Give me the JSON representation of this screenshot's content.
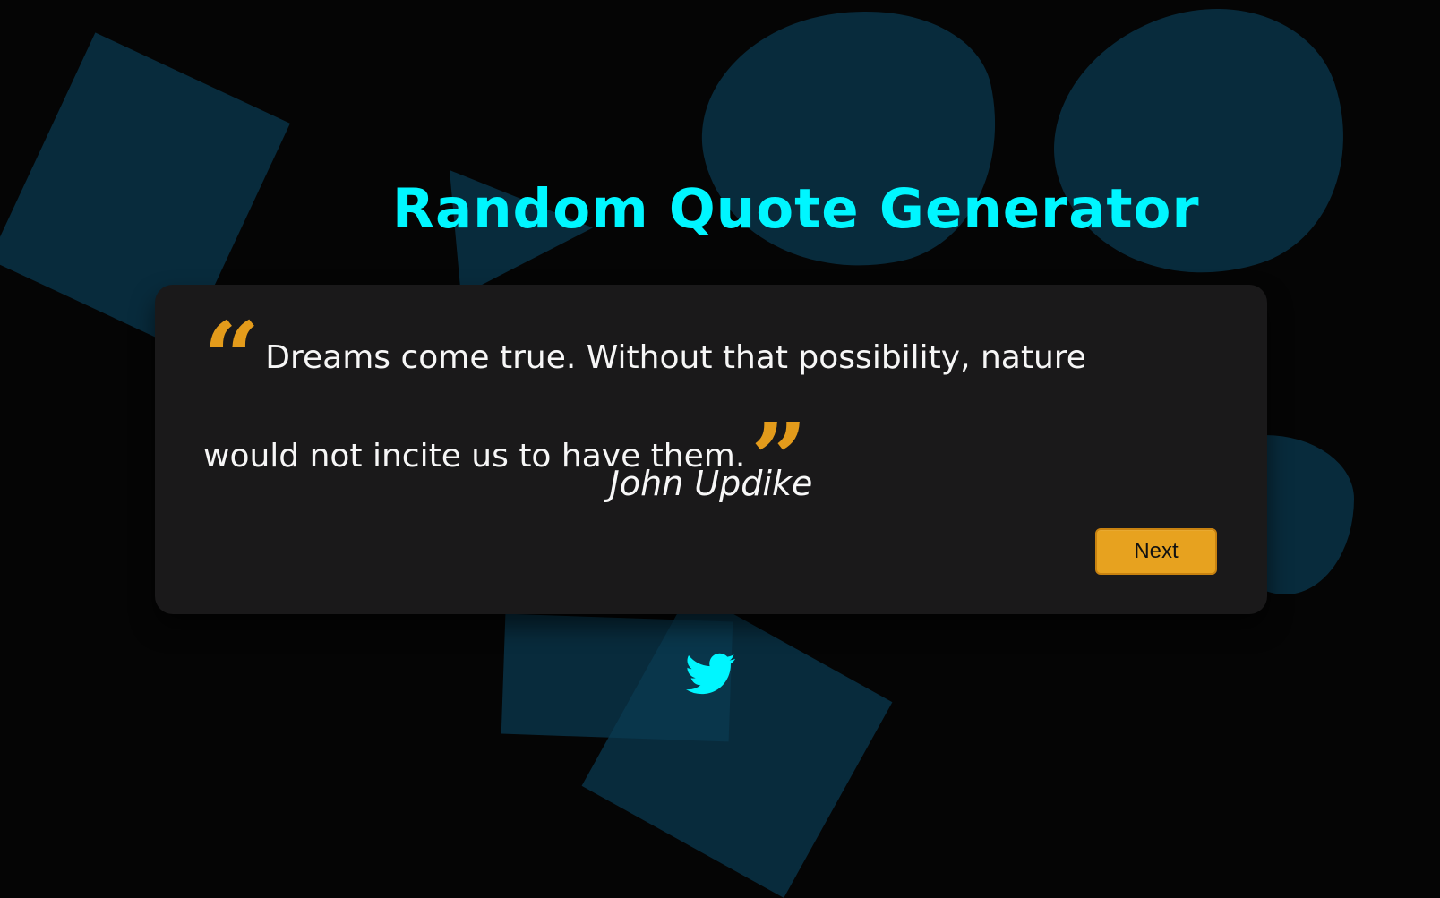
{
  "title": "Random Quote Generator",
  "quote": {
    "text": "Dreams come true. Without that possibility, nature would not incite us to have them.",
    "author": "John Updike",
    "open_mark": "“",
    "close_mark": "”"
  },
  "actions": {
    "next_label": "Next"
  },
  "icons": {
    "open_quote": "quote-open-icon",
    "close_quote": "quote-close-icon",
    "twitter": "twitter-icon"
  },
  "colors": {
    "background": "#050505",
    "card": "#1a191a",
    "title": "#00f6ff",
    "accent": "#e7a21f",
    "text": "#f6f6f6",
    "shape": "#0a3a52"
  }
}
